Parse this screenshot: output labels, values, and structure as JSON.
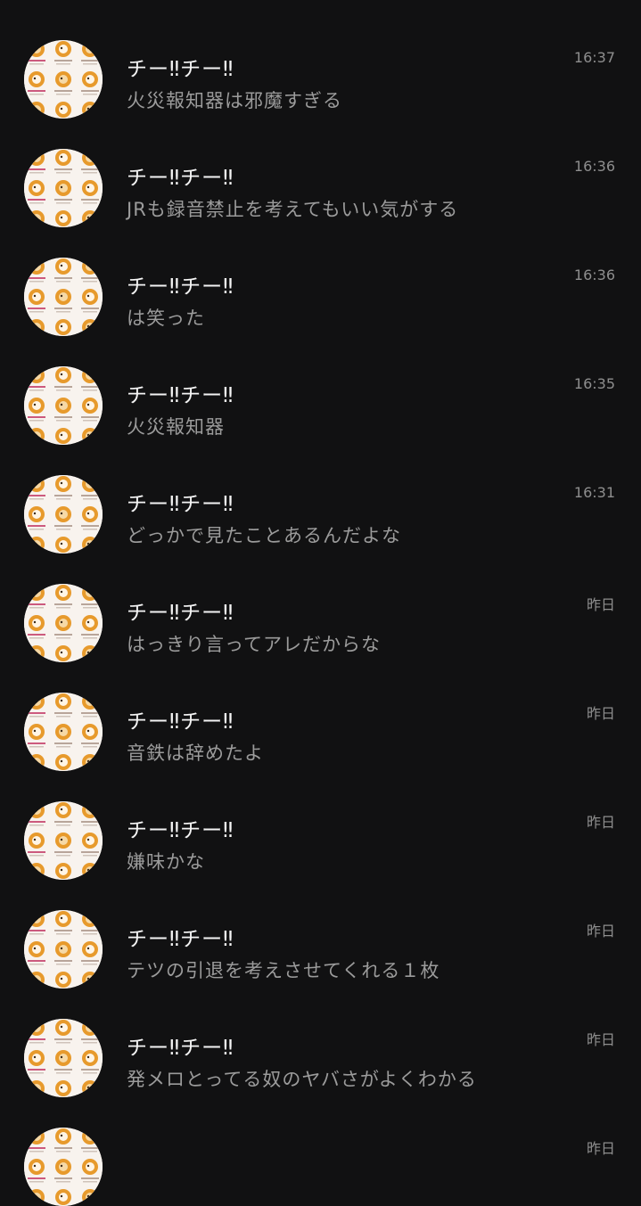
{
  "chats": [
    {
      "name": "チー‼チー‼",
      "message": "火災報知器は邪魔すぎる",
      "time": "16:37",
      "avatar_icon": "sticker-collage-avatar"
    },
    {
      "name": "チー‼チー‼",
      "message": "JRも録音禁止を考えてもいい気がする",
      "time": "16:36",
      "avatar_icon": "sticker-collage-avatar"
    },
    {
      "name": "チー‼チー‼",
      "message": "は笑った",
      "time": "16:36",
      "avatar_icon": "sticker-collage-avatar"
    },
    {
      "name": "チー‼チー‼",
      "message": "火災報知器",
      "time": "16:35",
      "avatar_icon": "sticker-collage-avatar"
    },
    {
      "name": "チー‼チー‼",
      "message": "どっかで見たことあるんだよな",
      "time": "16:31",
      "avatar_icon": "sticker-collage-avatar"
    },
    {
      "name": "チー‼チー‼",
      "message": "はっきり言ってアレだからな",
      "time": "昨日",
      "avatar_icon": "sticker-collage-avatar"
    },
    {
      "name": "チー‼チー‼",
      "message": "音鉄は辞めたよ",
      "time": "昨日",
      "avatar_icon": "sticker-collage-avatar"
    },
    {
      "name": "チー‼チー‼",
      "message": "嫌味かな",
      "time": "昨日",
      "avatar_icon": "sticker-collage-avatar"
    },
    {
      "name": "チー‼チー‼",
      "message": "テツの引退を考えさせてくれる１枚",
      "time": "昨日",
      "avatar_icon": "sticker-collage-avatar"
    },
    {
      "name": "チー‼チー‼",
      "message": "発メロとってる奴のヤバさがよくわかる",
      "time": "昨日",
      "avatar_icon": "sticker-collage-avatar"
    },
    {
      "name": "",
      "message": "",
      "time": "昨日",
      "avatar_icon": "sticker-collage-avatar"
    }
  ],
  "colors": {
    "background": "#111112",
    "name_text": "#f4f4f4",
    "message_text": "#9b9b9b",
    "time_text": "#8e8e8e",
    "avatar_orange": "#e79a2c",
    "avatar_pink": "#cc5a7e"
  }
}
